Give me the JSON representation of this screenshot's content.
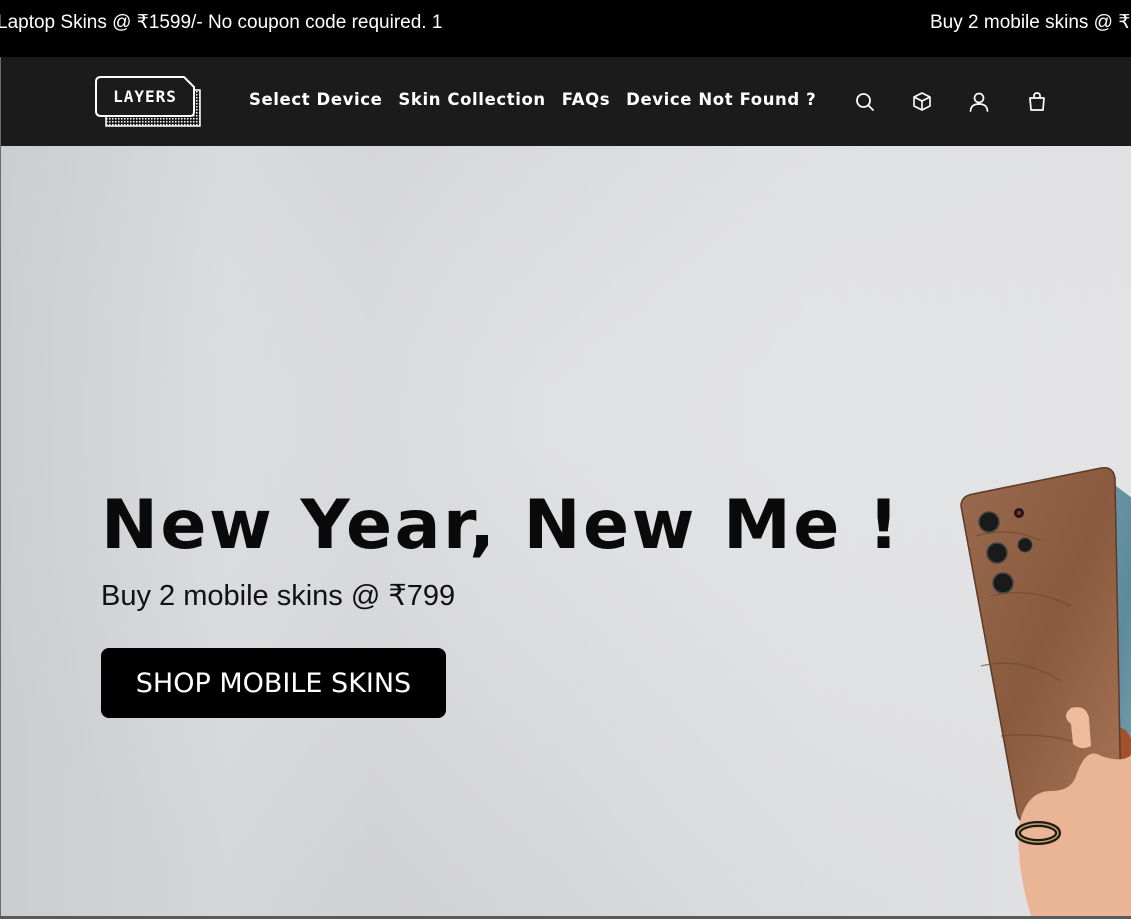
{
  "announcement": {
    "messages": [
      "Laptop Skins @ ₹1599/- No coupon code required. 1",
      "Buy 2 mobile skins @ ₹"
    ]
  },
  "header": {
    "logo_text": "LAYERS",
    "nav": [
      {
        "label": "Select Device"
      },
      {
        "label": "Skin Collection"
      },
      {
        "label": "FAQs"
      },
      {
        "label": "Device Not Found ?"
      }
    ],
    "icons": [
      "search-icon",
      "box-icon",
      "account-icon",
      "cart-icon"
    ]
  },
  "hero": {
    "title": "New Year, New Me !",
    "subtitle": "Buy 2 mobile skins @ ₹799",
    "cta_label": "SHOP MOBILE SKINS",
    "image_alt": "Hand holding phones with textured skins"
  },
  "colors": {
    "announcement_bg": "#000000",
    "header_bg": "#1b1b1b",
    "cta_bg": "#000000",
    "hero_bg": "#dadbde"
  }
}
